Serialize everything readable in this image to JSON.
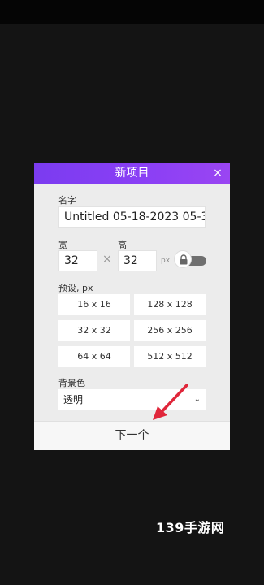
{
  "dialog": {
    "title": "新项目",
    "close_glyph": "×",
    "name_label": "名字",
    "name_value": "Untitled 05-18-2023 05-3",
    "width_label": "宽",
    "width_value": "32",
    "height_label": "高",
    "height_value": "32",
    "times_glyph": "×",
    "unit": "px",
    "aspect_lock_icon": "lock-icon",
    "presets_label": "预设, px",
    "presets": [
      "16 x 16",
      "128 x 128",
      "32 x 32",
      "256 x 256",
      "64 x 64",
      "512 x 512"
    ],
    "bg_label": "背景色",
    "bg_value": "透明",
    "next_label": "下一个"
  },
  "watermark": "139手游网",
  "colors": {
    "header_gradient_start": "#7b3cf0",
    "header_gradient_end": "#9a45f2",
    "arrow": "#e0263a",
    "background": "#141414"
  }
}
